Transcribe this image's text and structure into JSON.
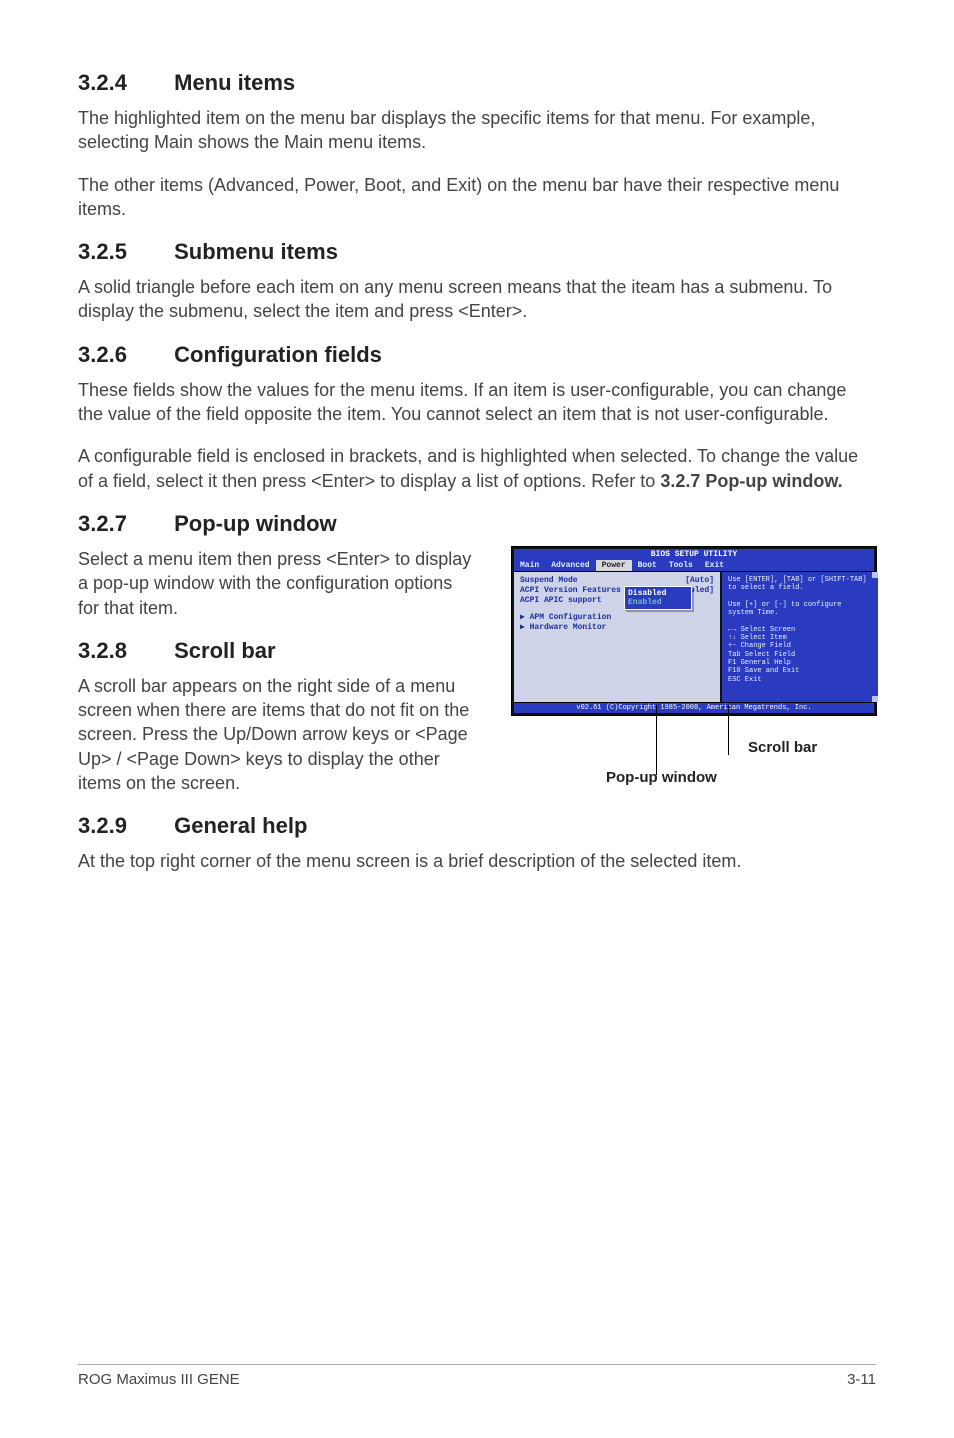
{
  "sections": {
    "s324": {
      "num": "3.2.4",
      "title": "Menu items",
      "p1": "The highlighted item on the menu bar displays the specific items for that menu. For example, selecting Main shows the Main menu items.",
      "p2": "The other items (Advanced, Power, Boot, and Exit) on the menu bar have their respective menu items."
    },
    "s325": {
      "num": "3.2.5",
      "title": "Submenu items",
      "p1": "A solid triangle before each item on any menu screen means that the iteam has a submenu. To display the submenu, select the item and press <Enter>."
    },
    "s326": {
      "num": "3.2.6",
      "title": "Configuration fields",
      "p1": "These fields show the values for the menu items. If an item is user-configurable, you can change the value of the field opposite the item. You cannot select an item that is not user-configurable.",
      "p2a": "A configurable field is enclosed in brackets, and is highlighted when selected. To change the value of a field, select it then press <Enter> to display a list of options. Refer to ",
      "p2b": "3.2.7 Pop-up window."
    },
    "s327": {
      "num": "3.2.7",
      "title": "Pop-up window",
      "p1": "Select a menu item then press <Enter> to display a pop-up window with the configuration options for that item."
    },
    "s328": {
      "num": "3.2.8",
      "title": "Scroll bar",
      "p1": "A scroll bar appears on the right side of a menu screen when there are items that do not fit on the screen. Press the Up/Down arrow keys or <Page Up> / <Page Down> keys to display the other items on the screen."
    },
    "s329": {
      "num": "3.2.9",
      "title": "General help",
      "p1": "At the top right corner of the menu screen is a brief description of the selected item."
    }
  },
  "bios": {
    "title": "BIOS SETUP UTILITY",
    "menu": [
      "Main",
      "Advanced",
      "Power",
      "Boot",
      "Tools",
      "Exit"
    ],
    "menu_selected_index": 2,
    "left_rows": [
      {
        "label": "Suspend Mode",
        "value": "[Auto]"
      },
      {
        "label": "ACPI Version Features",
        "value": "[Disabled]"
      },
      {
        "label": "ACPI APIC support",
        "value": ""
      }
    ],
    "sub_items": [
      "APM Configuration",
      "Hardware Monitor"
    ],
    "popup_options": [
      "Disabled",
      "Enabled"
    ],
    "popup_selected_index": 0,
    "help_line1": "Use [ENTER], [TAB] or [SHIFT-TAB] to select a field.",
    "help_line2": "Use [+] or [-] to configure system Time.",
    "keys": [
      "←→   Select Screen",
      "↑↓   Select Item",
      "+-   Change Field",
      "Tab  Select Field",
      "F1   General Help",
      "F10  Save and Exit",
      "ESC  Exit"
    ],
    "footer": "v02.61 (C)Copyright 1985-2008, American Megatrends, Inc."
  },
  "callouts": {
    "scrollbar": "Scroll bar",
    "popup": "Pop-up window"
  },
  "footer": {
    "left": "ROG Maximus III GENE",
    "right": "3-11"
  }
}
